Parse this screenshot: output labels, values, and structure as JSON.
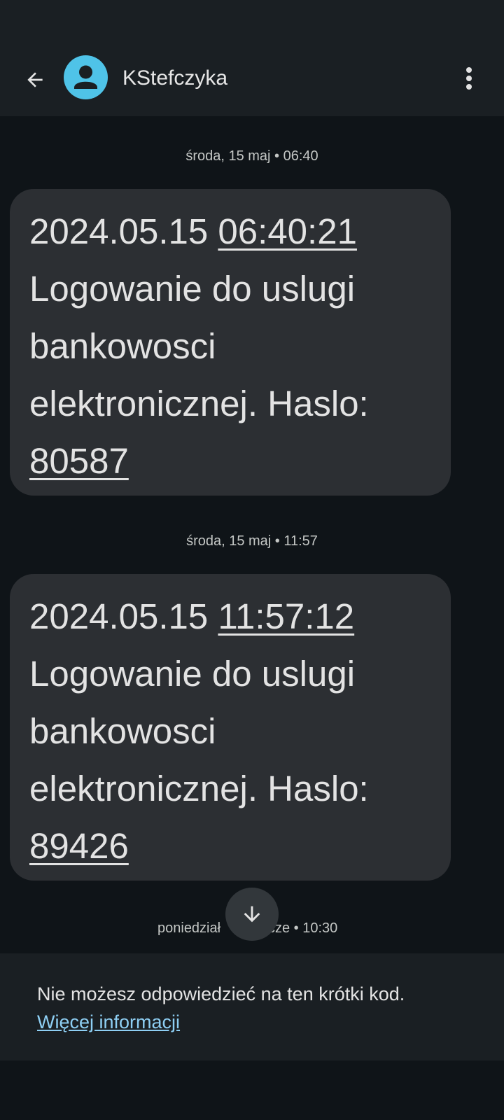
{
  "header": {
    "contact_name": "KStefczyka",
    "back_icon": "arrow-left-icon",
    "avatar_icon": "person-icon",
    "more_icon": "more-vertical-icon"
  },
  "messages": [
    {
      "date_label": "środa, 15 maj • 06:40",
      "date": "2024.05.15",
      "time_link": "06:40:21",
      "line1": "Logowanie do uslugi",
      "line2": "bankowosci",
      "line3": "elektronicznej. Haslo:",
      "code_link": "80587"
    },
    {
      "date_label": "środa, 15 maj • 11:57",
      "date": "2024.05.15",
      "time_link": "11:57:12",
      "line1": "Logowanie do uslugi",
      "line2": "bankowosci",
      "line3": "elektronicznej. Haslo:",
      "code_link": "89426"
    }
  ],
  "partial_date_label": {
    "left": "poniedział",
    "right": "cze • 10:30"
  },
  "scroll_button_icon": "arrow-down-icon",
  "footer": {
    "notice": "Nie możesz odpowiedzieć na ten krótki kod.",
    "more_info_link": "Więcej informacji"
  },
  "colors": {
    "background": "#0f1418",
    "bar": "#1a1f23",
    "bubble": "#2c2f33",
    "avatar": "#4fc3e8",
    "link": "#8ecff4"
  }
}
